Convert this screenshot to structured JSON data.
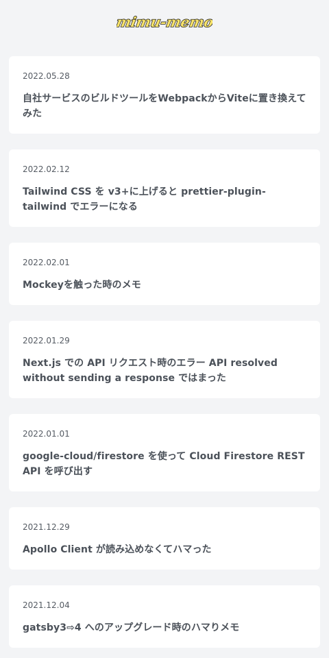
{
  "site": {
    "logo_text": "mimu-memo",
    "colors": {
      "background": "#f3f4f6",
      "card": "#ffffff",
      "logo_fill": "#f9e46b",
      "logo_outline": "#222222"
    }
  },
  "posts": [
    {
      "date": "2022.05.28",
      "title": "自社サービスのビルドツールをWebpackからViteに置き換えてみた"
    },
    {
      "date": "2022.02.12",
      "title": "Tailwind CSS を v3+に上げると prettier-plugin-tailwind でエラーになる"
    },
    {
      "date": "2022.02.01",
      "title": "Mockeyを触った時のメモ"
    },
    {
      "date": "2022.01.29",
      "title": "Next.js での API リクエスト時のエラー API resolved without sending a response ではまった"
    },
    {
      "date": "2022.01.01",
      "title": "google-cloud/firestore を使って Cloud Firestore REST API を呼び出す"
    },
    {
      "date": "2021.12.29",
      "title": "Apollo Client が読み込めなくてハマった"
    },
    {
      "date": "2021.12.04",
      "title": "gatsby3⇨4 へのアップグレード時のハマりメモ"
    }
  ]
}
